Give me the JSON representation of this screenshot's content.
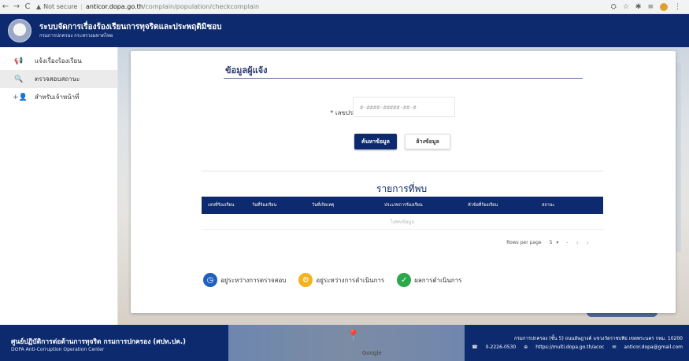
{
  "browser": {
    "not_secure": "Not secure",
    "domain": "anticor.dopa.go.th",
    "path": "/complain/population/checkcomplain"
  },
  "header": {
    "title": "ระบบจัดการเรื่องร้องเรียนการทุจริตและประพฤติมิชอบ",
    "subtitle": "กรมการปกครอง กระทรวงมหาดไทย"
  },
  "sidebar": {
    "items": [
      {
        "label": "แจ้งเรื่องร้องเรียน"
      },
      {
        "label": "ตรวจสอบสถานะ"
      },
      {
        "label": "สำหรับเจ้าหน้าที่"
      }
    ]
  },
  "form": {
    "section_title": "ข้อมูลผู้แจ้ง",
    "id_label": "* เลขประจำตัวประชาชน",
    "id_placeholder": "#-####-#####-##-#",
    "search_button": "ค้นหาข้อมูล",
    "clear_button": "ล้างข้อมูล"
  },
  "results": {
    "title": "รายการที่พบ",
    "columns": [
      "เลขที่ร้องเรียน",
      "วันที่ร้องเรียน",
      "วันที่เกิดเหตุ",
      "ประเภทการร้องเรียน",
      "หัวข้อที่ร้องเรียน",
      "สถานะ"
    ],
    "empty_text": "ไม่พบข้อมูล",
    "rows_per_page_label": "Rows per page",
    "rows_per_page": "5",
    "page_range": "-"
  },
  "legend": {
    "items": [
      {
        "label": "อยู่ระหว่างการตรวจสอบ",
        "color": "#1f5fbf"
      },
      {
        "label": "อยู่ระหว่างการดำเนินการ",
        "color": "#f2b31d"
      },
      {
        "label": "ผลการดำเนินการ",
        "color": "#2aa84a"
      }
    ]
  },
  "footer": {
    "title": "ศูนย์ปฏิบัติการต่อต้านการทุจริต กรมการปกครอง (ศปท.ปค.)",
    "subtitle": "DOPA Anti-Corruption Operation Center",
    "address": "กรมการปกครอง (ชั้น 5) ถนนอัษฎางค์ แขวงวัดราชบพิธ เขตพระนคร กทม. 10200",
    "phone": "0-2226-0530",
    "website": "https://multi.dopa.go.th/acoc",
    "email": "anticor.dopa@gmail.com",
    "map_logo": "Google"
  }
}
